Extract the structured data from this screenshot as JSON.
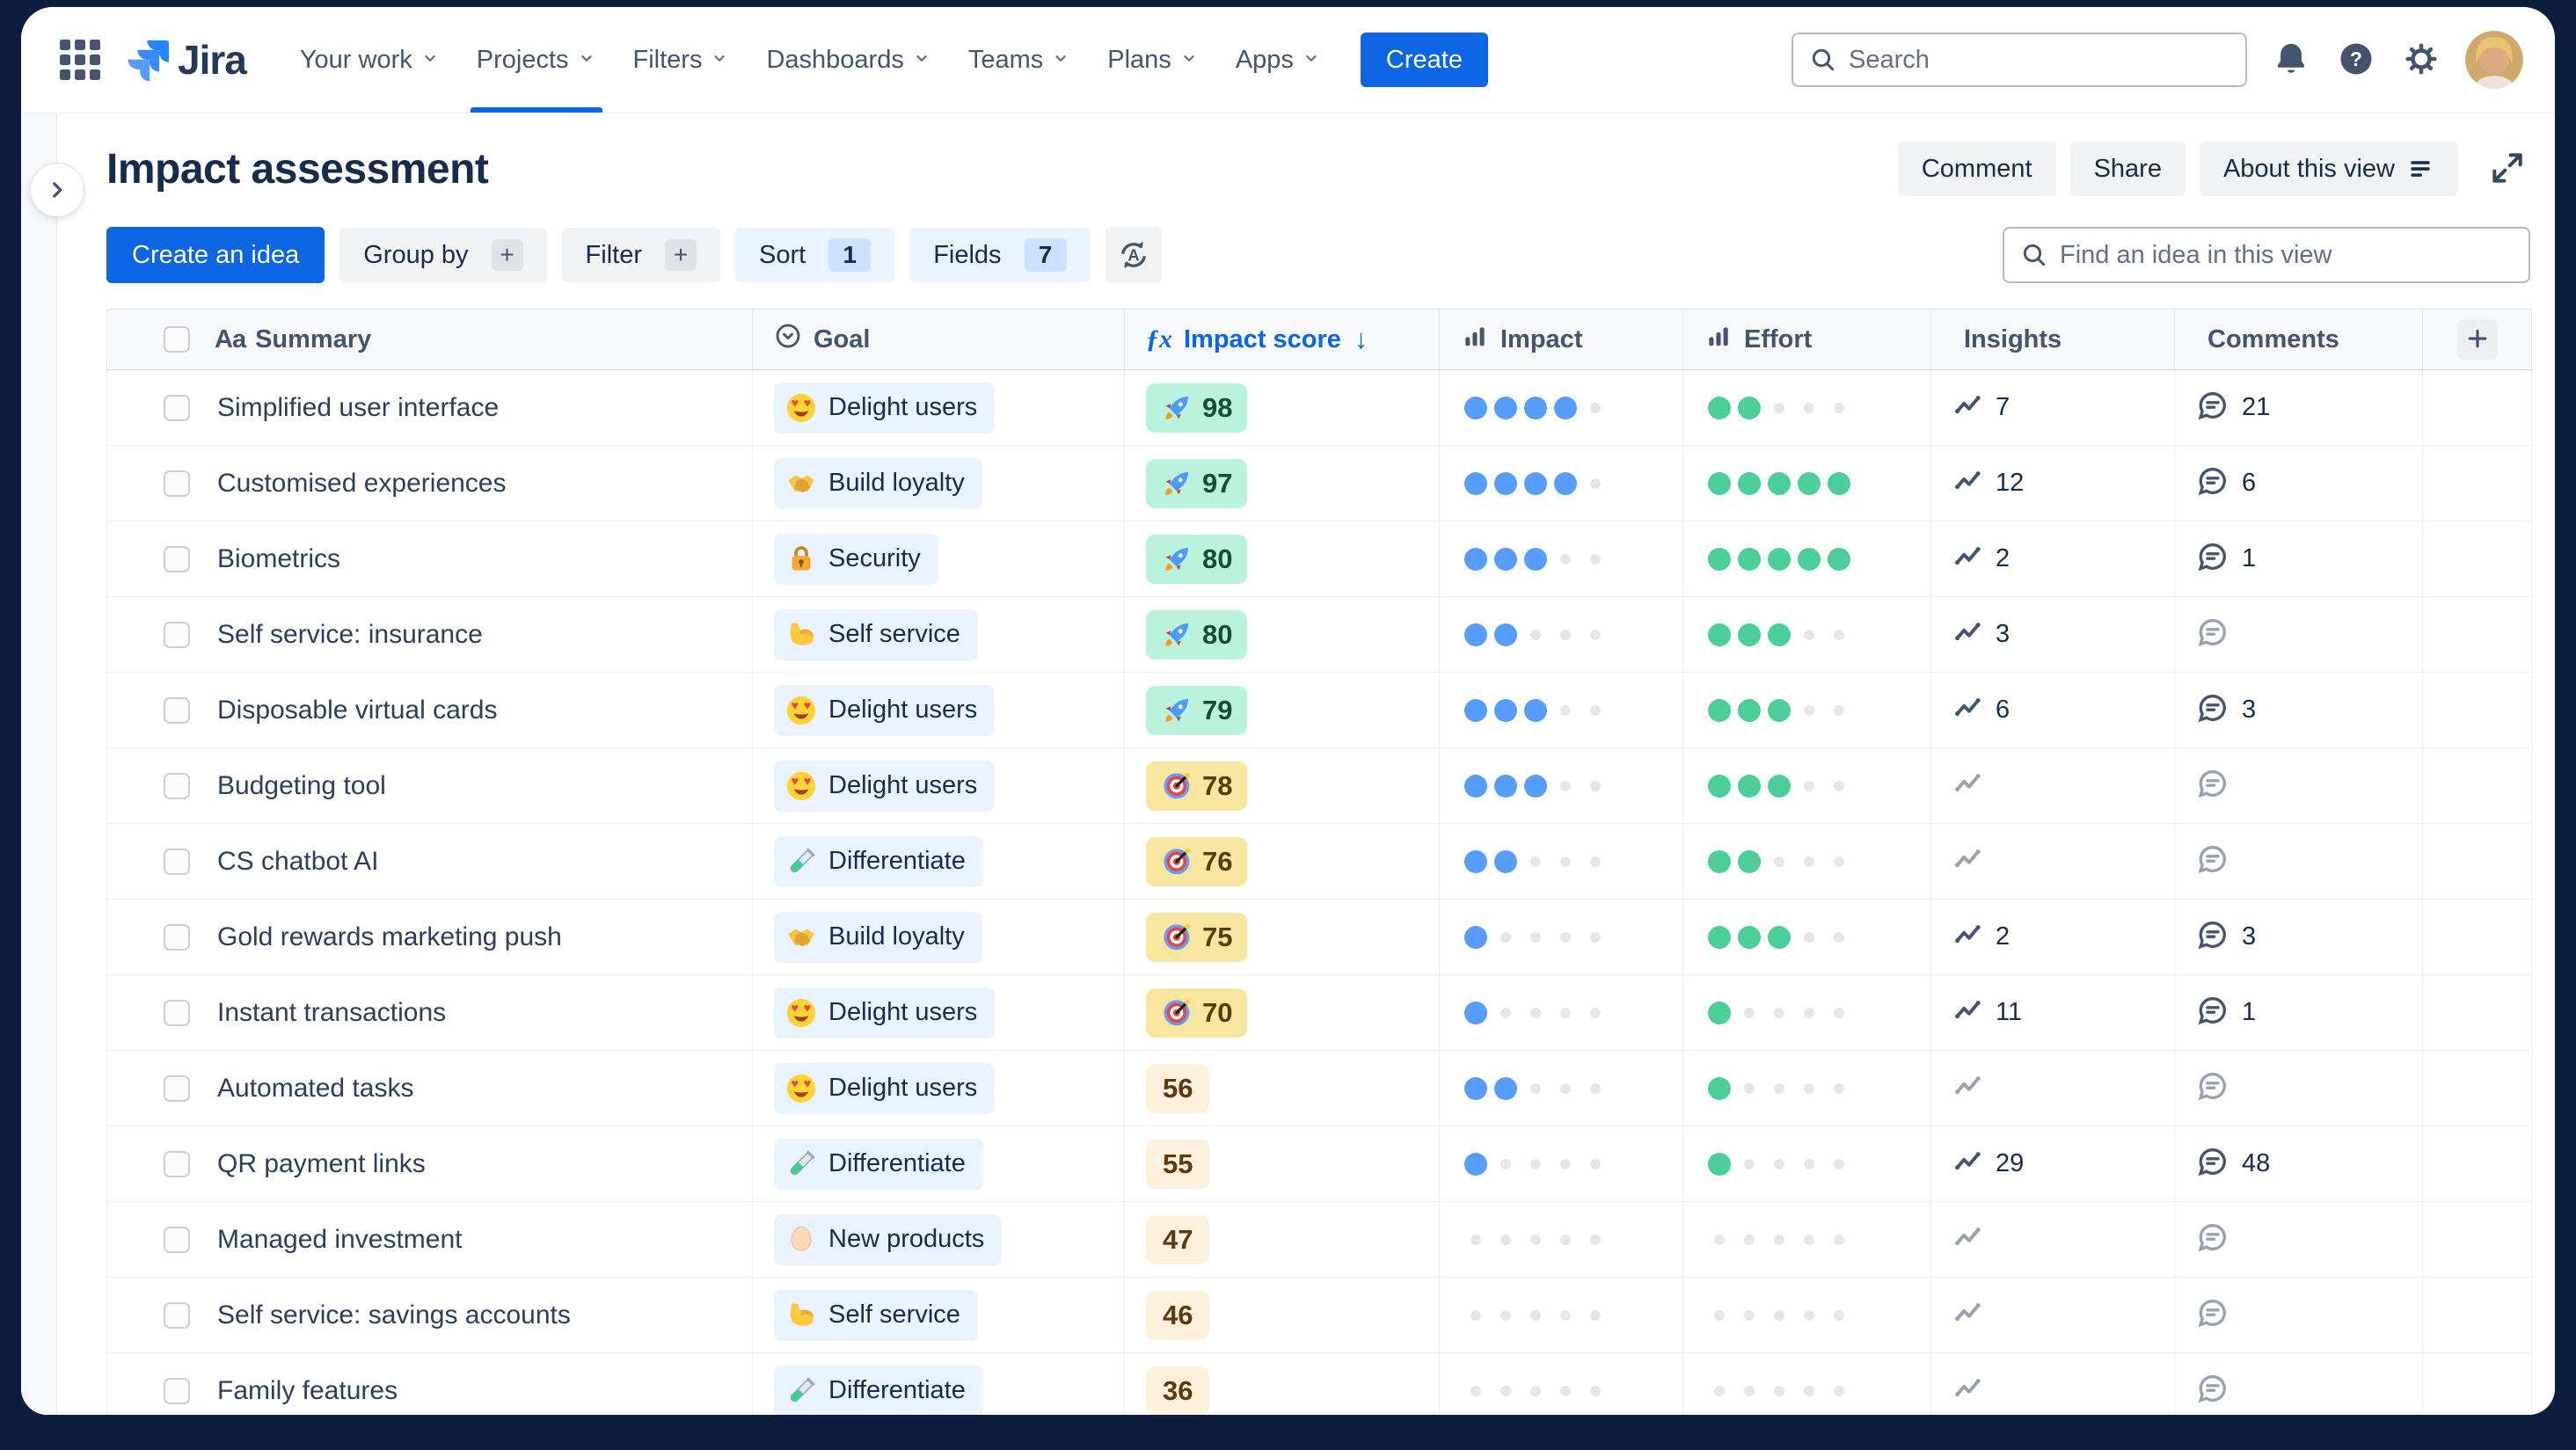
{
  "nav": {
    "logo_text": "Jira",
    "items": [
      {
        "label": "Your work",
        "has_dropdown": true,
        "active": false
      },
      {
        "label": "Projects",
        "has_dropdown": true,
        "active": true
      },
      {
        "label": "Filters",
        "has_dropdown": true,
        "active": false
      },
      {
        "label": "Dashboards",
        "has_dropdown": true,
        "active": false
      },
      {
        "label": "Teams",
        "has_dropdown": true,
        "active": false
      },
      {
        "label": "Plans",
        "has_dropdown": true,
        "active": false
      },
      {
        "label": "Apps",
        "has_dropdown": true,
        "active": false
      }
    ],
    "create_label": "Create",
    "search_placeholder": "Search"
  },
  "page": {
    "title": "Impact assessment",
    "actions": {
      "comment": "Comment",
      "share": "Share",
      "about": "About this view"
    }
  },
  "toolbar": {
    "create_idea_label": "Create an idea",
    "group_by_label": "Group by",
    "filter_label": "Filter",
    "sort_label": "Sort",
    "sort_count": "1",
    "fields_label": "Fields",
    "fields_count": "7",
    "find_placeholder": "Find an idea in this view"
  },
  "table": {
    "rating_scale_max": 5,
    "columns": [
      {
        "id": "summary",
        "label": "Summary",
        "icon": "aa-icon"
      },
      {
        "id": "goal",
        "label": "Goal",
        "icon": "circle-chevron-icon"
      },
      {
        "id": "impact_score",
        "label": "Impact score",
        "icon": "fx-icon",
        "sort": "desc"
      },
      {
        "id": "impact",
        "label": "Impact",
        "icon": "bar-chart-icon"
      },
      {
        "id": "effort",
        "label": "Effort",
        "icon": "bar-chart-icon"
      },
      {
        "id": "insights",
        "label": "Insights",
        "icon": "trend-icon"
      },
      {
        "id": "comments",
        "label": "Comments",
        "icon": "comment-icon"
      },
      {
        "id": "add_column",
        "label": "",
        "icon": "plus-icon"
      }
    ],
    "rows": [
      {
        "summary": "Simplified user interface",
        "goal": {
          "label": "Delight users",
          "emoji": "😍",
          "icon": "heart-eyes-face"
        },
        "impact_score": {
          "value": "98",
          "tier": "high",
          "emoji": "🚀"
        },
        "impact": 4,
        "effort": 2,
        "insights": "7",
        "comments": "21"
      },
      {
        "summary": "Customised experiences",
        "goal": {
          "label": "Build loyalty",
          "emoji": "🤝",
          "icon": "handshake"
        },
        "impact_score": {
          "value": "97",
          "tier": "high",
          "emoji": "🚀"
        },
        "impact": 4,
        "effort": 5,
        "insights": "12",
        "comments": "6"
      },
      {
        "summary": "Biometrics",
        "goal": {
          "label": "Security",
          "emoji": "🔐",
          "icon": "locked-with-key"
        },
        "impact_score": {
          "value": "80",
          "tier": "high",
          "emoji": "🚀"
        },
        "impact": 3,
        "effort": 5,
        "insights": "2",
        "comments": "1"
      },
      {
        "summary": "Self service: insurance",
        "goal": {
          "label": "Self service",
          "emoji": "💪",
          "icon": "flexed-biceps"
        },
        "impact_score": {
          "value": "80",
          "tier": "high",
          "emoji": "🚀"
        },
        "impact": 2,
        "effort": 3,
        "insights": "3",
        "comments": null
      },
      {
        "summary": "Disposable virtual cards",
        "goal": {
          "label": "Delight users",
          "emoji": "😍",
          "icon": "heart-eyes-face"
        },
        "impact_score": {
          "value": "79",
          "tier": "high",
          "emoji": "🚀"
        },
        "impact": 3,
        "effort": 3,
        "insights": "6",
        "comments": "3"
      },
      {
        "summary": "Budgeting tool",
        "goal": {
          "label": "Delight users",
          "emoji": "😍",
          "icon": "heart-eyes-face"
        },
        "impact_score": {
          "value": "78",
          "tier": "mid",
          "emoji": "🎯"
        },
        "impact": 3,
        "effort": 3,
        "insights": null,
        "comments": null
      },
      {
        "summary": "CS chatbot AI",
        "goal": {
          "label": "Differentiate",
          "emoji": "🧪",
          "icon": "test-tube"
        },
        "impact_score": {
          "value": "76",
          "tier": "mid",
          "emoji": "🎯"
        },
        "impact": 2,
        "effort": 2,
        "insights": null,
        "comments": null
      },
      {
        "summary": "Gold rewards marketing push",
        "goal": {
          "label": "Build loyalty",
          "emoji": "🤝",
          "icon": "handshake"
        },
        "impact_score": {
          "value": "75",
          "tier": "mid",
          "emoji": "🎯"
        },
        "impact": 1,
        "effort": 3,
        "insights": "2",
        "comments": "3"
      },
      {
        "summary": "Instant transactions",
        "goal": {
          "label": "Delight users",
          "emoji": "😍",
          "icon": "heart-eyes-face"
        },
        "impact_score": {
          "value": "70",
          "tier": "mid",
          "emoji": "🎯"
        },
        "impact": 1,
        "effort": 1,
        "insights": "11",
        "comments": "1"
      },
      {
        "summary": "Automated tasks",
        "goal": {
          "label": "Delight users",
          "emoji": "😍",
          "icon": "heart-eyes-face"
        },
        "impact_score": {
          "value": "56",
          "tier": "low",
          "emoji": null
        },
        "impact": 2,
        "effort": 1,
        "insights": null,
        "comments": null
      },
      {
        "summary": "QR payment links",
        "goal": {
          "label": "Differentiate",
          "emoji": "🧪",
          "icon": "test-tube"
        },
        "impact_score": {
          "value": "55",
          "tier": "low",
          "emoji": null
        },
        "impact": 1,
        "effort": 1,
        "insights": "29",
        "comments": "48"
      },
      {
        "summary": "Managed investment",
        "goal": {
          "label": "New products",
          "emoji": "🥚",
          "icon": "egg"
        },
        "impact_score": {
          "value": "47",
          "tier": "low",
          "emoji": null
        },
        "impact": 0,
        "effort": 0,
        "insights": null,
        "comments": null
      },
      {
        "summary": "Self service: savings accounts",
        "goal": {
          "label": "Self service",
          "emoji": "💪",
          "icon": "flexed-biceps"
        },
        "impact_score": {
          "value": "46",
          "tier": "low",
          "emoji": null
        },
        "impact": 0,
        "effort": 0,
        "insights": null,
        "comments": null
      },
      {
        "summary": "Family features",
        "goal": {
          "label": "Differentiate",
          "emoji": "🧪",
          "icon": "test-tube"
        },
        "impact_score": {
          "value": "36",
          "tier": "low",
          "emoji": null
        },
        "impact": 0,
        "effort": 0,
        "insights": null,
        "comments": null
      }
    ]
  },
  "colors": {
    "frame_navy": "#0c1c3d",
    "accent_blue": "#0c66e4",
    "impact_dot_blue": "#579dff",
    "effort_dot_green": "#4bce97",
    "score_high_bg": "#baf3db",
    "score_high_text": "#164b35",
    "score_mid_bg": "#f8e6a0",
    "score_mid_text": "#533f04",
    "score_low_bg": "#fdf0dc",
    "score_low_text": "#5f3811",
    "goal_badge_bg": "#e9f2ff",
    "table_header_bg": "#f7f8f9"
  }
}
